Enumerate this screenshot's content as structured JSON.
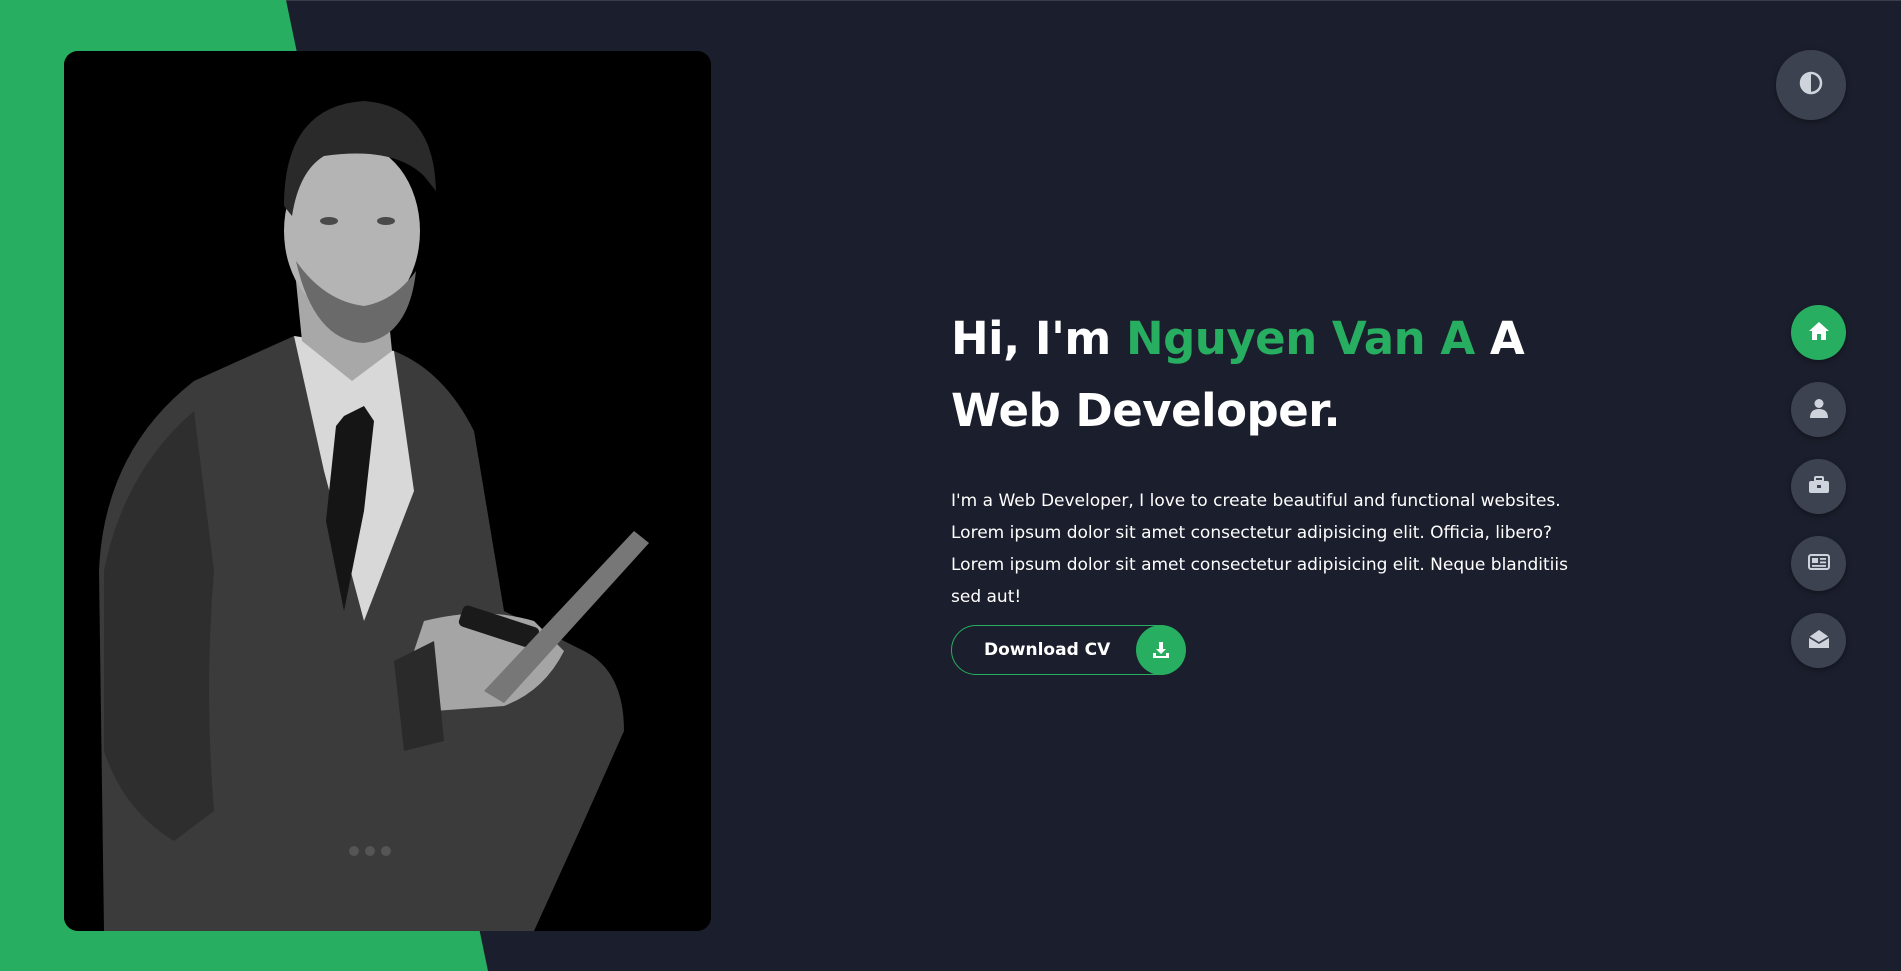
{
  "hero": {
    "greeting": "Hi, I'm",
    "name": "Nguyen Van A",
    "role_suffix": "A",
    "role": "Web Developer.",
    "description": "I'm a Web Developer, I love to create beautiful and functional websites. Lorem ipsum dolor sit amet consectetur adipisicing elit. Officia, libero? Lorem ipsum dolor sit amet consectetur adipisicing elit. Neque blanditiis sed aut!",
    "download_label": "Download CV",
    "download_icon": "download-icon"
  },
  "theme_toggle": {
    "icon": "contrast-icon"
  },
  "side_nav": {
    "items": [
      {
        "icon": "home-icon",
        "active": true
      },
      {
        "icon": "user-icon",
        "active": false
      },
      {
        "icon": "briefcase-icon",
        "active": false
      },
      {
        "icon": "newspaper-icon",
        "active": false
      },
      {
        "icon": "envelope-open-icon",
        "active": false
      }
    ]
  },
  "colors": {
    "background": "#1b1e2c",
    "accent": "#27ae60",
    "nav_button": "#3d4251",
    "text": "#ffffff"
  }
}
